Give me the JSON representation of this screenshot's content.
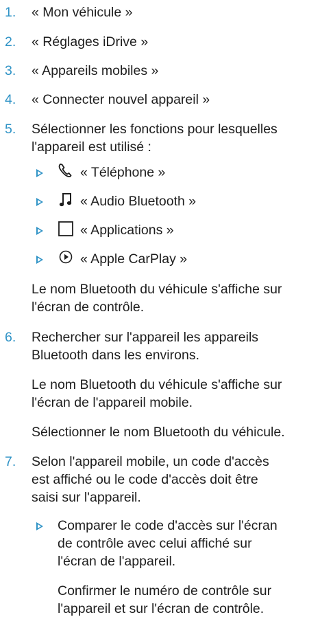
{
  "steps": [
    {
      "number": "1.",
      "lines": [
        "« Mon véhicule »"
      ]
    },
    {
      "number": "2.",
      "lines": [
        "« Réglages iDrive »"
      ]
    },
    {
      "number": "3.",
      "lines": [
        "« Appareils mobiles »"
      ]
    },
    {
      "number": "4.",
      "lines": [
        "« Connecter nouvel appareil »"
      ]
    },
    {
      "number": "5.",
      "lines": [
        "Sélectionner les fonctions pour lesquelles",
        "l'appareil est utilisé :"
      ]
    },
    {
      "number": "6.",
      "lines": [
        "Rechercher sur l'appareil les appareils",
        "Bluetooth dans les environs."
      ]
    },
    {
      "number": "7.",
      "lines": [
        "Selon l'appareil mobile, un code d'accès",
        "est affiché ou le code d'accès doit être",
        "saisi sur l'appareil."
      ]
    }
  ],
  "step5_options": [
    {
      "icon": "phone-icon",
      "label": "« Téléphone »"
    },
    {
      "icon": "music-note-icon",
      "label": "« Audio Bluetooth »"
    },
    {
      "icon": "apps-square-icon",
      "label": "« Applications »"
    },
    {
      "icon": "carplay-icon",
      "label": "« Apple CarPlay »"
    }
  ],
  "step5_result": [
    "Le nom Bluetooth du véhicule s'affiche sur",
    "l'écran de contrôle."
  ],
  "step6_result": [
    "Le nom Bluetooth du véhicule s'affiche sur",
    "l'écran de l'appareil mobile."
  ],
  "step6_action": "Sélectionner le nom Bluetooth du véhicule.",
  "step7_sub": {
    "lines": [
      "Comparer le code d'accès sur l'écran",
      "de contrôle avec celui affiché sur",
      "l'écran de l'appareil."
    ],
    "confirm": [
      "Confirmer le numéro de contrôle sur",
      "l'appareil et sur l'écran de contrôle."
    ]
  },
  "colors": {
    "accent": "#2f93c6",
    "text": "#1e1e1e"
  }
}
